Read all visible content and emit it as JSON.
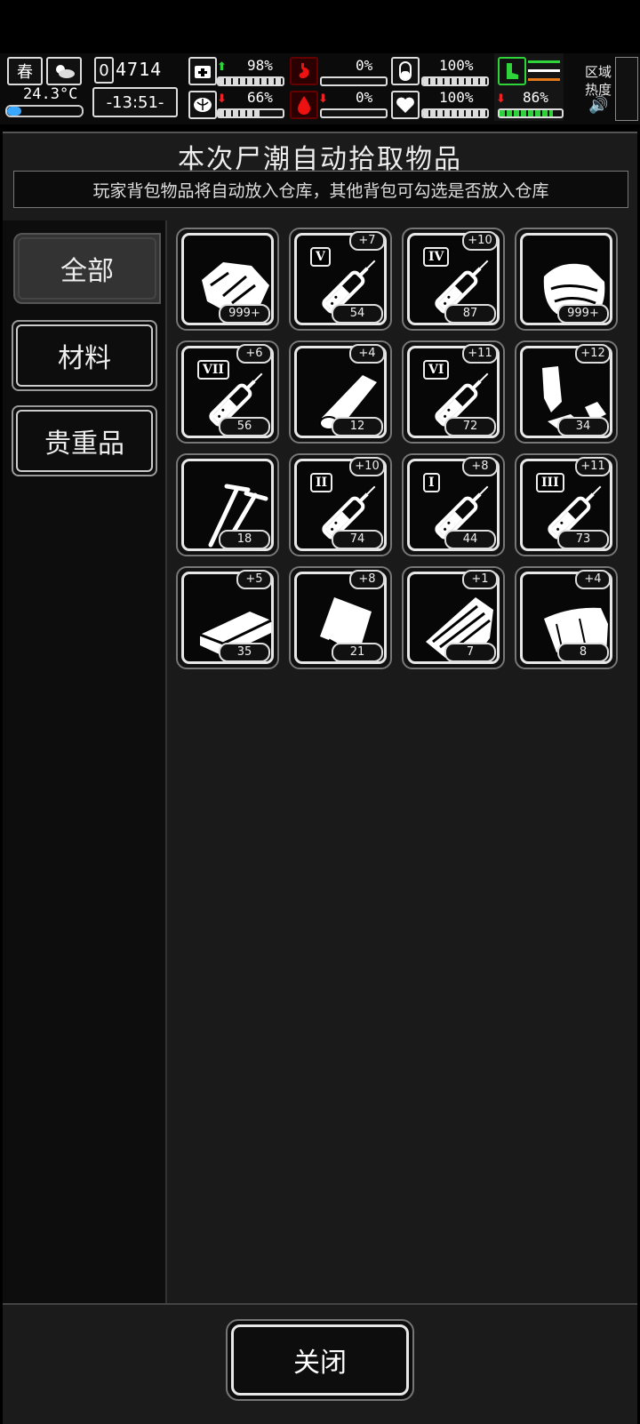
{
  "status": {
    "season": "春",
    "temperature": "24.3°C",
    "day": "0",
    "day_counter": "4714",
    "clock": "-13:51-",
    "heat_label_1": "区域",
    "heat_label_2": "热度",
    "stats": [
      {
        "name": "health",
        "value": "98%",
        "trend": "up",
        "fill": 0.98
      },
      {
        "name": "stomach",
        "value": "0%",
        "trend": "none",
        "fill": 0.0
      },
      {
        "name": "pill",
        "value": "100%",
        "trend": "none",
        "fill": 1.0
      },
      {
        "name": "mental",
        "value": "66%",
        "trend": "down",
        "fill": 0.66
      },
      {
        "name": "blood",
        "value": "0%",
        "trend": "down",
        "fill": 0.0
      },
      {
        "name": "heart",
        "value": "100%",
        "trend": "none",
        "fill": 1.0
      },
      {
        "name": "stamina",
        "value": "86%",
        "trend": "down",
        "fill": 0.86
      }
    ]
  },
  "panel": {
    "title": "本次尸潮自动拾取物品",
    "subtitle": "玩家背包物品将自动放入仓库，其他背包可勾选是否放入仓库"
  },
  "tabs": [
    "全部",
    "材料",
    "贵重品"
  ],
  "items": [
    {
      "icon": "meat-icon",
      "count": "999+",
      "plus": "",
      "roman": ""
    },
    {
      "icon": "syringe-icon",
      "count": "54",
      "plus": "+7",
      "roman": "V"
    },
    {
      "icon": "syringe-icon",
      "count": "87",
      "plus": "+10",
      "roman": "IV"
    },
    {
      "icon": "cloth-icon",
      "count": "999+",
      "plus": "",
      "roman": ""
    },
    {
      "icon": "syringe-icon",
      "count": "56",
      "plus": "+6",
      "roman": "VII"
    },
    {
      "icon": "bandage-roll-icon",
      "count": "12",
      "plus": "+4",
      "roman": ""
    },
    {
      "icon": "syringe-icon",
      "count": "72",
      "plus": "+11",
      "roman": "VI"
    },
    {
      "icon": "scrap-icon",
      "count": "34",
      "plus": "+12",
      "roman": ""
    },
    {
      "icon": "nails-icon",
      "count": "18",
      "plus": "",
      "roman": ""
    },
    {
      "icon": "syringe-icon",
      "count": "74",
      "plus": "+10",
      "roman": "II"
    },
    {
      "icon": "syringe-icon",
      "count": "44",
      "plus": "+8",
      "roman": "I"
    },
    {
      "icon": "syringe-icon",
      "count": "73",
      "plus": "+11",
      "roman": "III"
    },
    {
      "icon": "brick-icon",
      "count": "35",
      "plus": "+5",
      "roman": ""
    },
    {
      "icon": "bag-icon",
      "count": "21",
      "plus": "+8",
      "roman": ""
    },
    {
      "icon": "wood-plank-icon",
      "count": "7",
      "plus": "+1",
      "roman": ""
    },
    {
      "icon": "cloth-sheet-icon",
      "count": "8",
      "plus": "+4",
      "roman": ""
    }
  ],
  "footer": {
    "close_label": "关闭"
  }
}
